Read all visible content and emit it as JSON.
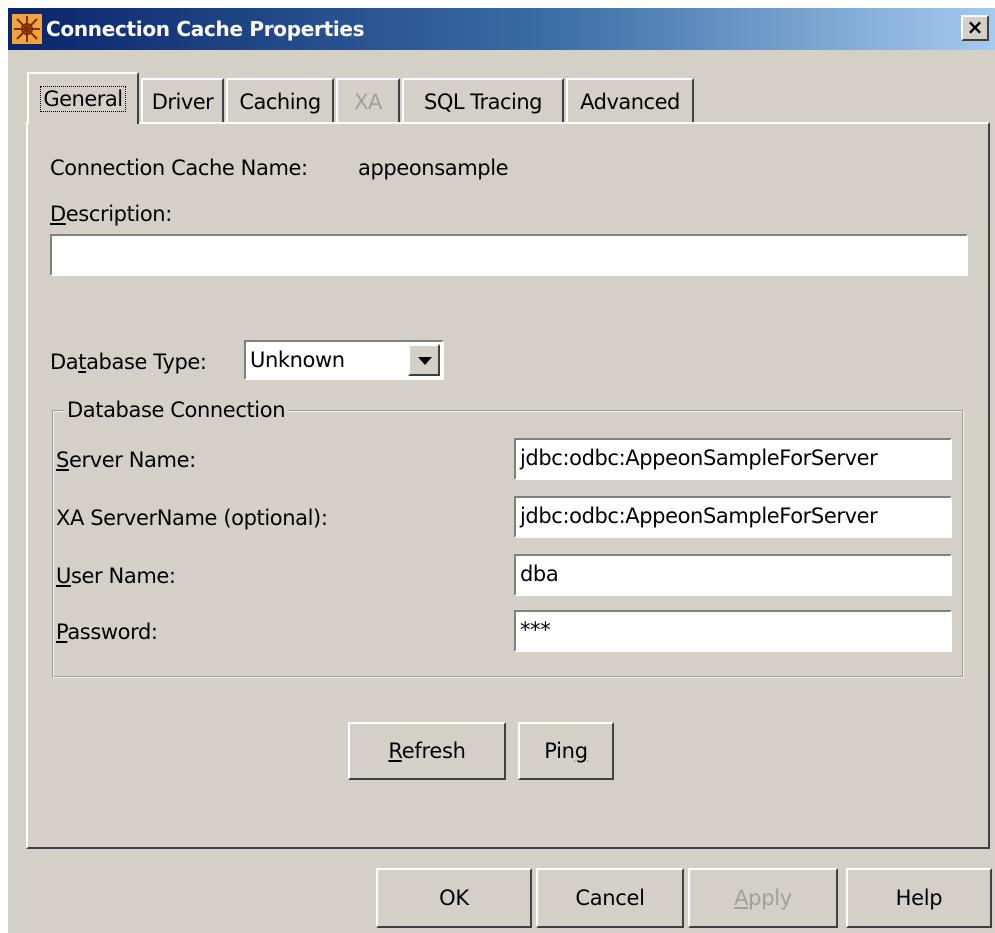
{
  "window": {
    "title": "Connection Cache Properties",
    "close_glyph": "×",
    "title_icon": "sun-logo-icon"
  },
  "tabs": [
    {
      "label": "General",
      "state": "active"
    },
    {
      "label": "Driver",
      "state": "normal"
    },
    {
      "label": "Caching",
      "state": "normal"
    },
    {
      "label": "XA",
      "state": "disabled"
    },
    {
      "label": "SQL Tracing",
      "state": "normal"
    },
    {
      "label": "Advanced",
      "state": "normal"
    }
  ],
  "general": {
    "cache_name_label": "Connection Cache Name:",
    "cache_name_value": "appeonsample",
    "description_label": {
      "first": "D",
      "rest": "escription:"
    },
    "description_value": "",
    "db_type_label": {
      "pre": "Da",
      "ul": "t",
      "post": "abase Type:"
    },
    "db_type_value": "Unknown",
    "db_connection": {
      "legend": "Database Connection",
      "server_name_label": {
        "first": "S",
        "rest": "erver Name:"
      },
      "server_name_value": "jdbc:odbc:AppeonSampleForServer",
      "xa_server_label": "XA ServerName (optional):",
      "xa_server_value": "jdbc:odbc:AppeonSampleForServer",
      "user_name_label": {
        "first": "U",
        "rest": "ser Name:"
      },
      "user_name_value": "dba",
      "password_label": {
        "first": "P",
        "rest": "assword:"
      },
      "password_value": "***"
    },
    "refresh_button": {
      "first": "R",
      "rest": "efresh"
    },
    "ping_button": {
      "pre": "Pin",
      "ul": "g"
    }
  },
  "footer": {
    "ok_label": "OK",
    "cancel_label": "Cancel",
    "apply_label": {
      "first": "A",
      "rest": "pply"
    },
    "help_label": "Help"
  },
  "colors": {
    "face": "#d4d0c8",
    "title_start": "#0a246a",
    "title_end": "#a6caf0",
    "disabled_text": "#a0a0a0"
  }
}
